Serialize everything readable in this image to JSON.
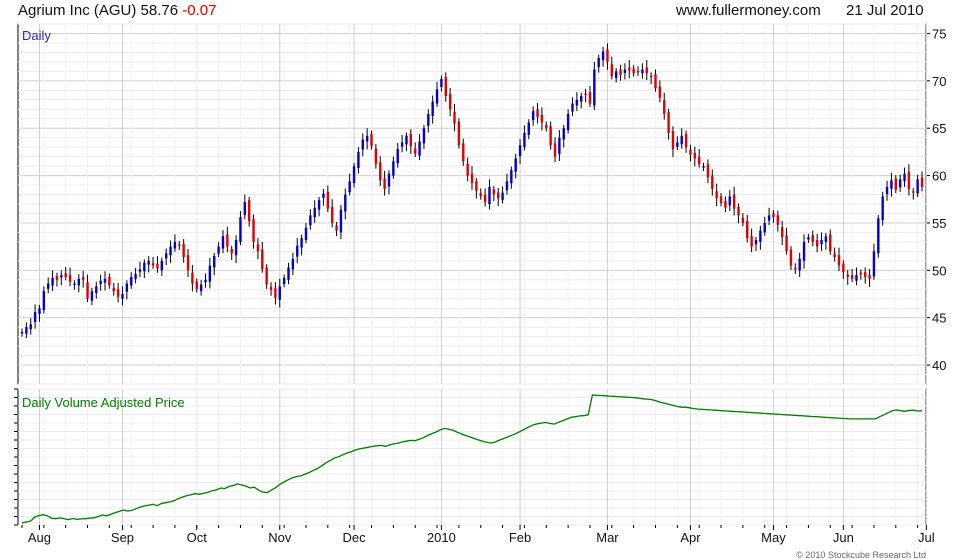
{
  "header": {
    "ticker_name": "Agrium Inc (AGU)",
    "last_price": "58.76",
    "change": "-0.07",
    "site": "www.fullermoney.com",
    "date": "21 Jul 2010"
  },
  "copyright": "© 2010 Stockcube Research Ltd",
  "colors": {
    "up": "#0000cc",
    "down": "#dd0000",
    "line": "#007a00",
    "grid": "#cfcfcf",
    "label_price": "#2a2aa0"
  },
  "chart_data": [
    {
      "type": "candlestick",
      "title": "Daily",
      "ylim": [
        38,
        76
      ],
      "yticks": [
        40,
        45,
        50,
        55,
        60,
        65,
        70,
        75
      ],
      "x_tick_labels": [
        "Aug",
        "Sep",
        "Oct",
        "Nov",
        "Dec",
        "2010",
        "Feb",
        "Mar",
        "Apr",
        "May",
        "Jun",
        "Jul"
      ],
      "x_tick_index": [
        4,
        23,
        40,
        59,
        76,
        96,
        114,
        134,
        153,
        172,
        188,
        207
      ],
      "closes": [
        43.5,
        44.0,
        44.3,
        45.6,
        46.0,
        47.8,
        48.6,
        49.2,
        49.0,
        49.5,
        49.3,
        48.8,
        48.6,
        49.1,
        49.0,
        47.0,
        47.8,
        48.3,
        48.9,
        49.1,
        48.4,
        47.8,
        47.2,
        47.5,
        48.6,
        49.3,
        49.6,
        50.1,
        50.8,
        51.0,
        50.5,
        50.2,
        51.0,
        51.8,
        52.5,
        53.0,
        52.6,
        51.4,
        50.0,
        48.6,
        48.0,
        48.5,
        49.0,
        50.5,
        51.5,
        52.5,
        53.6,
        52.5,
        51.8,
        53.2,
        55.6,
        57.2,
        55.2,
        53.0,
        52.0,
        50.1,
        48.5,
        47.9,
        47.1,
        48.3,
        49.2,
        50.3,
        51.2,
        52.6,
        53.4,
        54.5,
        55.8,
        56.6,
        57.4,
        58.1,
        56.5,
        55.0,
        54.2,
        56.4,
        58.0,
        59.4,
        61.0,
        62.5,
        63.8,
        64.2,
        63.1,
        61.2,
        59.5,
        58.6,
        60.2,
        61.5,
        62.8,
        63.5,
        64.2,
        63.1,
        62.3,
        63.6,
        65.0,
        66.5,
        67.8,
        69.1,
        70.2,
        68.4,
        67.0,
        65.5,
        63.2,
        61.5,
        60.0,
        59.2,
        58.4,
        57.8,
        57.2,
        58.8,
        58.0,
        57.6,
        58.2,
        59.4,
        60.6,
        61.8,
        63.2,
        64.5,
        65.6,
        66.8,
        66.2,
        65.6,
        65.0,
        63.2,
        62.0,
        64.0,
        65.0,
        66.5,
        67.6,
        68.0,
        68.4,
        68.6,
        67.6,
        71.2,
        72.4,
        73.1,
        72.0,
        70.5,
        71.0,
        70.6,
        71.2,
        71.1,
        70.8,
        71.0,
        71.2,
        70.8,
        70.5,
        69.2,
        68.2,
        66.5,
        64.5,
        62.8,
        63.5,
        64.2,
        63.0,
        62.2,
        61.8,
        61.2,
        61.0,
        59.8,
        58.6,
        57.6,
        57.1,
        56.6,
        57.8,
        56.5,
        55.8,
        55.0,
        53.4,
        52.5,
        53.2,
        54.2,
        55.0,
        55.8,
        55.6,
        54.8,
        53.5,
        52.0,
        50.5,
        50.2,
        51.2,
        53.0,
        53.5,
        53.0,
        52.5,
        53.2,
        53.6,
        52.0,
        51.4,
        50.5,
        49.8,
        49.3,
        49.1,
        49.5,
        49.6,
        49.3,
        49.1,
        52.0,
        55.5,
        57.8,
        58.8,
        59.5,
        58.5,
        59.6,
        60.2,
        58.6,
        58.3,
        59.6,
        58.8
      ],
      "panel": "Daily Volume Adjusted Price"
    },
    {
      "type": "line",
      "title": "Daily Volume Adjusted Price",
      "series": [
        {
          "values": [
            1.5,
            2.2,
            2.8,
            5.8,
            7.0,
            7.6,
            6.8,
            5.0,
            4.6,
            5.2,
            4.6,
            4.0,
            4.8,
            4.2,
            4.5,
            4.6,
            5.0,
            5.3,
            6.2,
            7.4,
            6.8,
            7.8,
            9.0,
            10.0,
            11.0,
            10.2,
            10.8,
            12.0,
            13.2,
            14.0,
            14.6,
            15.2,
            14.2,
            15.8,
            16.4,
            17.0,
            17.8,
            19.4,
            20.6,
            21.6,
            22.2,
            23.0,
            22.6,
            23.4,
            24.0,
            25.2,
            25.8,
            27.2,
            26.8,
            28.4,
            29.0,
            30.2,
            29.4,
            28.6,
            27.2,
            27.8,
            25.6,
            24.2,
            23.8,
            25.6,
            27.4,
            29.8,
            31.6,
            33.2,
            34.8,
            35.6,
            36.2,
            37.4,
            38.6,
            40.2,
            41.6,
            43.6,
            45.8,
            47.6,
            49.4,
            50.2,
            51.8,
            53.0,
            54.0,
            55.2,
            56.0,
            56.6,
            57.2,
            57.8,
            58.2,
            58.5,
            57.8,
            58.8,
            59.6,
            60.2,
            61.0,
            61.6,
            62.2,
            62.0,
            63.0,
            64.2,
            65.8,
            67.2,
            68.4,
            70.0,
            71.0,
            70.4,
            69.6,
            68.2,
            67.0,
            65.8,
            64.8,
            63.6,
            62.6,
            61.6,
            60.8,
            60.2,
            61.0,
            62.4,
            63.6,
            64.8,
            66.0,
            67.4,
            69.0,
            70.6,
            72.2,
            73.6,
            74.4,
            75.0,
            75.4,
            74.6,
            74.2,
            75.6,
            76.8,
            78.0,
            79.2,
            79.6,
            80.2,
            80.4,
            81.0,
            95.6,
            95.4,
            95.2,
            95.0,
            94.8,
            94.6,
            94.4,
            94.2,
            94.0,
            93.8,
            93.6,
            93.2,
            92.8,
            92.6,
            92.2,
            91.4,
            90.4,
            89.6,
            88.8,
            88.0,
            87.2,
            86.6,
            86.6,
            86.2,
            85.6,
            85.2,
            85.0,
            84.8,
            84.6,
            84.4,
            84.2,
            84.0,
            83.8,
            83.6,
            83.4,
            83.2,
            83.0,
            82.8,
            82.6,
            82.4,
            82.2,
            82.0,
            81.8,
            81.6,
            81.4,
            81.2,
            81.0,
            80.8,
            80.6,
            80.4,
            80.2,
            80.0,
            79.8,
            79.6,
            79.4,
            79.2,
            79.0,
            78.8,
            78.6,
            78.4,
            78.2,
            78.0,
            78.0,
            78.0,
            78.0,
            78.0,
            78.0,
            78.0,
            79.6,
            81.0,
            82.6,
            84.0,
            84.6,
            84.0,
            83.6,
            84.2,
            84.4,
            83.8,
            84.0
          ]
        }
      ],
      "ylim": [
        0,
        100
      ]
    }
  ]
}
